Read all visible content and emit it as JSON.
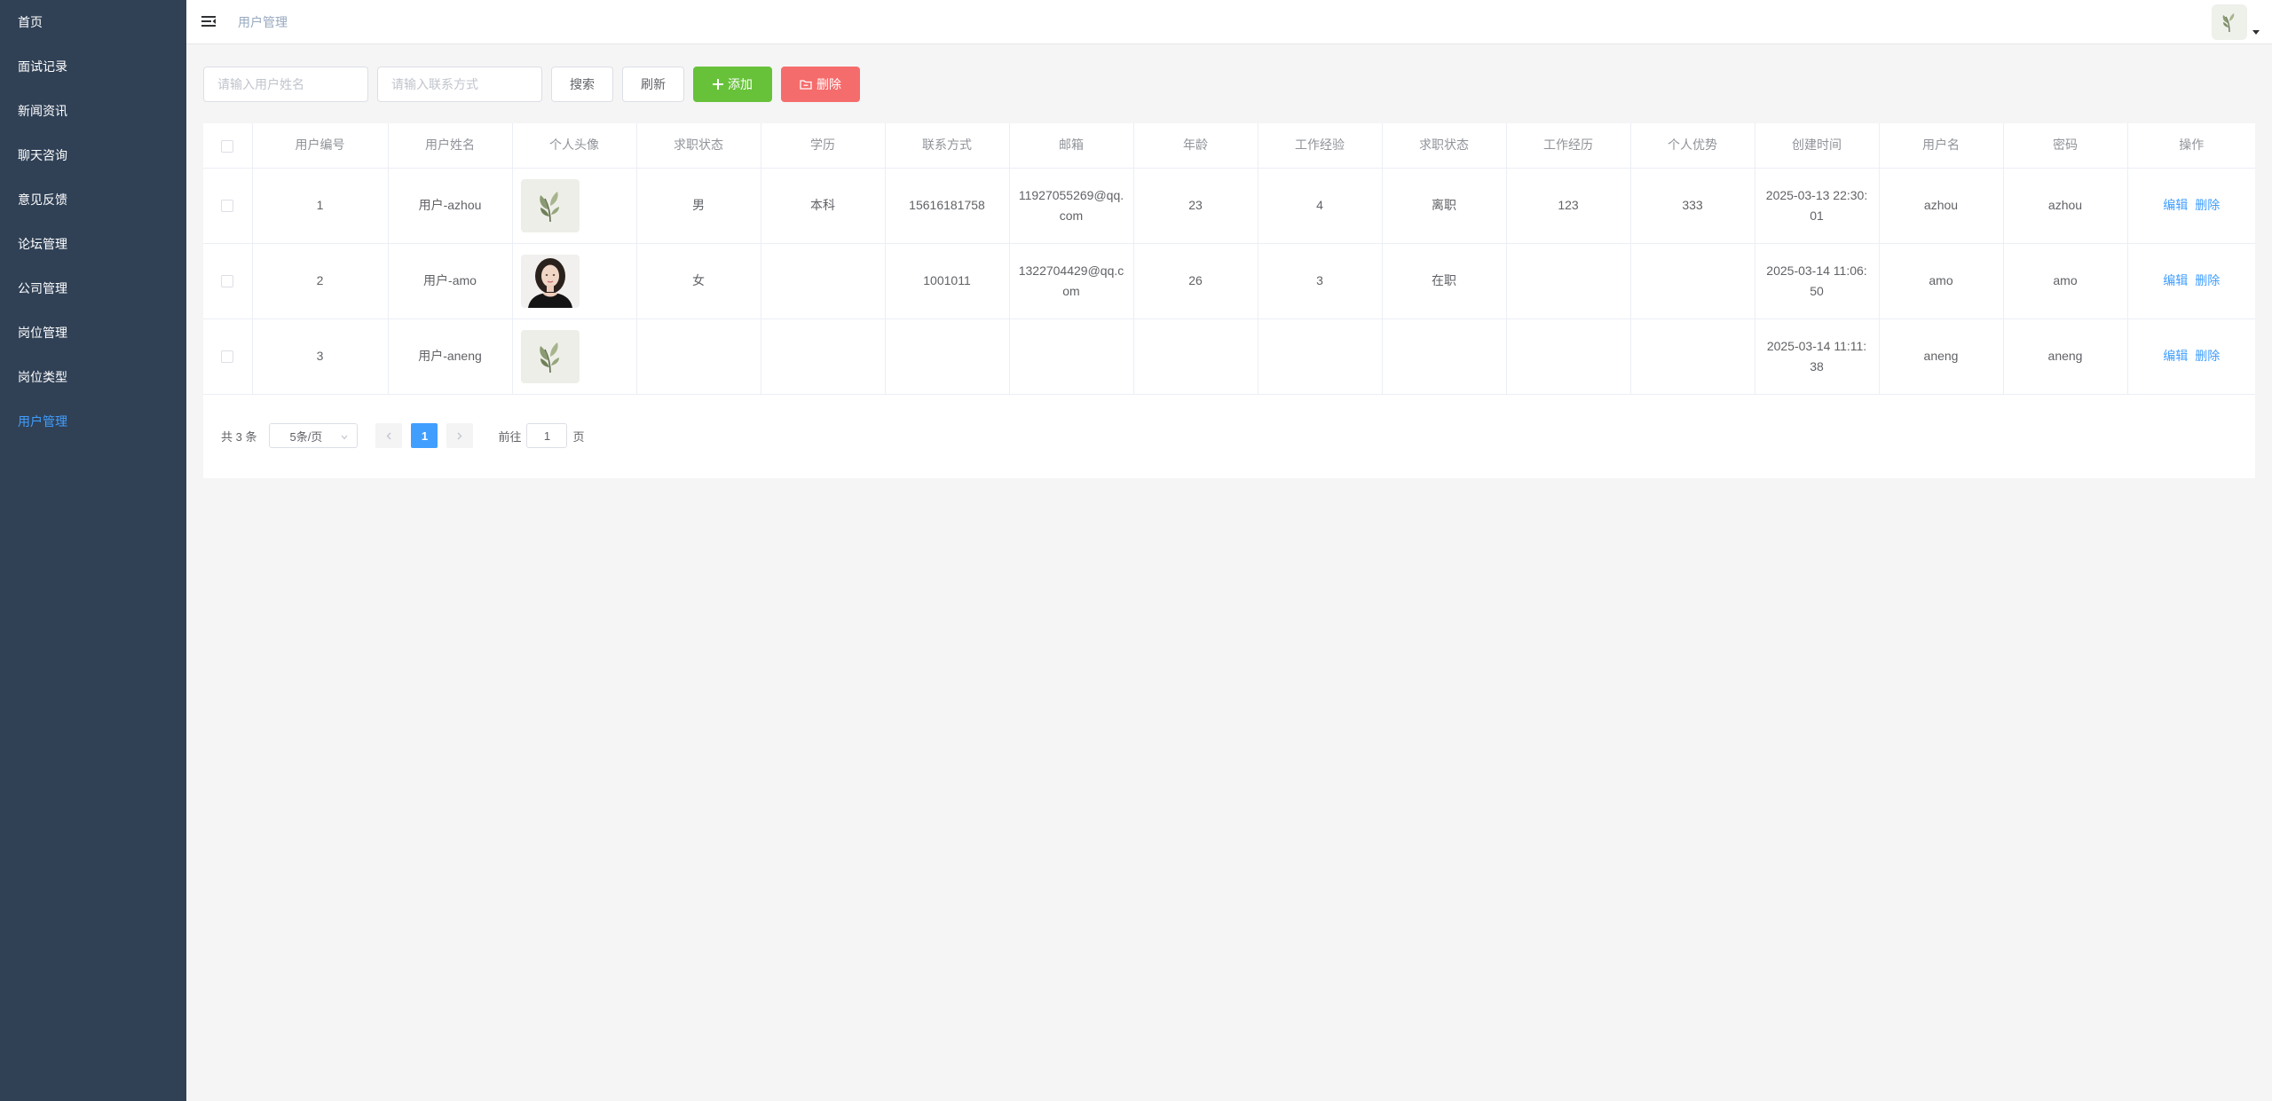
{
  "sidebar": {
    "items": [
      {
        "label": "首页"
      },
      {
        "label": "面试记录"
      },
      {
        "label": "新闻资讯"
      },
      {
        "label": "聊天咨询"
      },
      {
        "label": "意见反馈"
      },
      {
        "label": "论坛管理"
      },
      {
        "label": "公司管理"
      },
      {
        "label": "岗位管理"
      },
      {
        "label": "岗位类型"
      },
      {
        "label": "用户管理"
      }
    ],
    "active_index": 9
  },
  "header": {
    "breadcrumb": "用户管理"
  },
  "toolbar": {
    "name_placeholder": "请输入用户姓名",
    "contact_placeholder": "请输入联系方式",
    "search_label": "搜索",
    "refresh_label": "刷新",
    "add_label": "添加",
    "delete_label": "删除"
  },
  "table": {
    "headers": [
      "用户编号",
      "用户姓名",
      "个人头像",
      "求职状态",
      "学历",
      "联系方式",
      "邮箱",
      "年龄",
      "工作经验",
      "求职状态",
      "工作经历",
      "个人优势",
      "创建时间",
      "用户名",
      "密码",
      "操作"
    ],
    "rows": [
      {
        "id": "1",
        "name": "用户-azhou",
        "avatar": "plant-avatar",
        "gender": "男",
        "education": "本科",
        "phone": "15616181758",
        "email": "11927055269@qq.com",
        "age": "23",
        "experience": "4",
        "status": "离职",
        "history": "123",
        "advantage": "333",
        "created": "2025-03-13 22:30:01",
        "username": "azhou",
        "password": "azhou"
      },
      {
        "id": "2",
        "name": "用户-amo",
        "avatar": "portrait-avatar",
        "gender": "女",
        "education": "",
        "phone": "1001011",
        "email": "1322704429@qq.com",
        "age": "26",
        "experience": "3",
        "status": "在职",
        "history": "",
        "advantage": "",
        "created": "2025-03-14 11:06:50",
        "username": "amo",
        "password": "amo"
      },
      {
        "id": "3",
        "name": "用户-aneng",
        "avatar": "plant-avatar",
        "gender": "",
        "education": "",
        "phone": "",
        "email": "",
        "age": "",
        "experience": "",
        "status": "",
        "history": "",
        "advantage": "",
        "created": "2025-03-14 11:11:38",
        "username": "aneng",
        "password": "aneng"
      }
    ],
    "edit_label": "编辑",
    "delete_label": "删除"
  },
  "pagination": {
    "total_text": "共 3 条",
    "page_size": "5条/页",
    "current_page": "1",
    "goto_label": "前往",
    "goto_value": "1",
    "page_suffix": "页"
  },
  "colors": {
    "sidebar_bg": "#304156",
    "primary": "#409eff",
    "success": "#67c23a",
    "danger": "#f56c6c"
  }
}
